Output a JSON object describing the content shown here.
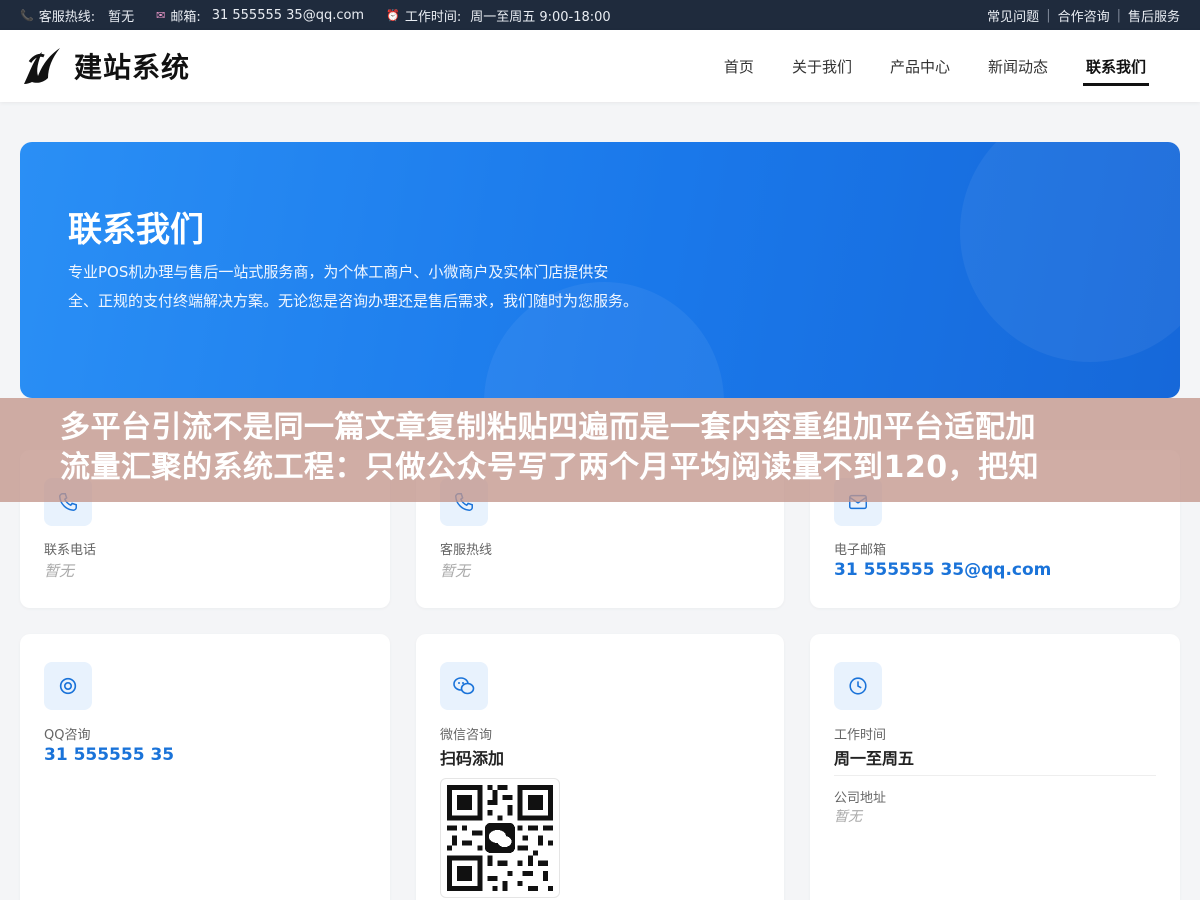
{
  "topbar": {
    "hotline_label": "客服热线:",
    "hotline_value": "暂无",
    "email_label": "邮箱:",
    "email_value": "31 555555 35@qq.com",
    "hours_label": "工作时间:",
    "hours_value": "周一至周五 9:00-18:00",
    "links": [
      "常见问题",
      "合作咨询",
      "售后服务"
    ]
  },
  "header": {
    "logo_text": "建站系统",
    "nav": [
      "首页",
      "关于我们",
      "产品中心",
      "新闻动态",
      "联系我们"
    ],
    "active_nav": "联系我们"
  },
  "hero": {
    "title": "联系我们",
    "description": "专业POS机办理与售后一站式服务商，为个体工商户、小微商户及实体门店提供安全、正规的支付终端解决方案。无论您是咨询办理还是售后需求，我们随时为您服务。"
  },
  "overlay": {
    "line1": "多平台引流不是同一篇文章复制粘贴四遍而是一套内容重组加平台适配加",
    "line2": "流量汇聚的系统工程：只做公众号写了两个月平均阅读量不到120，把知"
  },
  "cards": {
    "phone": {
      "label": "联系电话",
      "value": "暂无"
    },
    "hotline": {
      "label": "客服热线",
      "value": "暂无"
    },
    "email": {
      "label": "电子邮箱",
      "value": "31 555555 35@qq.com"
    },
    "qq": {
      "label": "QQ咨询",
      "value": "31 555555 35"
    },
    "wechat": {
      "label": "微信咨询",
      "value": "扫码添加"
    },
    "hours": {
      "label": "工作时间",
      "value": "周一至周五"
    },
    "address": {
      "label": "公司地址",
      "value": "暂无"
    }
  },
  "colors": {
    "accent": "#1a73d9",
    "topbar": "#1f2b3d",
    "hero": "#2a8ff5"
  }
}
